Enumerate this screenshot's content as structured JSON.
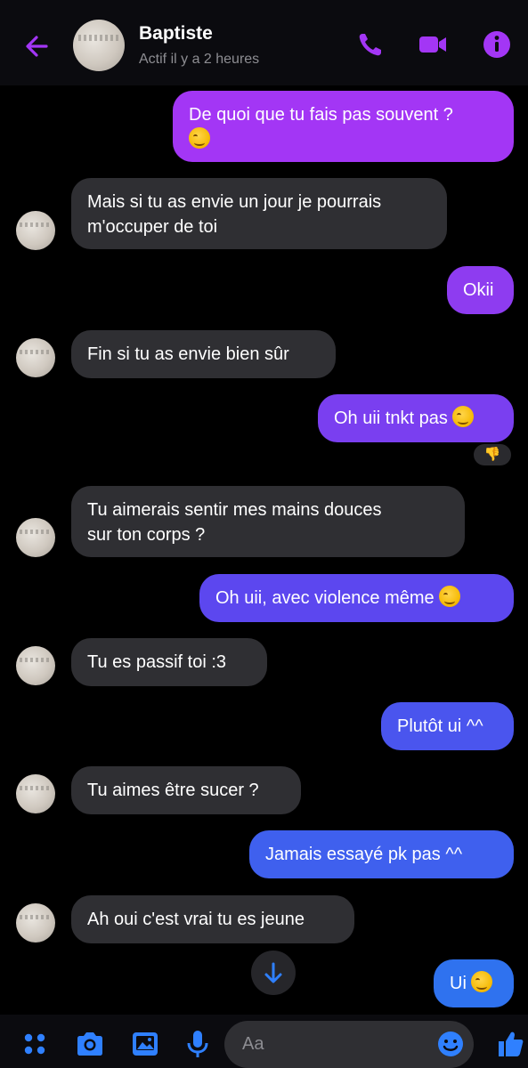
{
  "header": {
    "contact_name": "Baptiste",
    "status": "Actif il y a 2 heures"
  },
  "messages": [
    {
      "side": "out",
      "text": "De quoi que tu fais pas souvent ?",
      "color": "#a336f5"
    },
    {
      "side": "in",
      "line1": "Mais si tu as envie un jour je pourrais",
      "line2": "m'occuper de toi"
    },
    {
      "side": "out",
      "text": "Okii",
      "color": "#8e3cf0"
    },
    {
      "side": "in",
      "text": "Fin si tu as envie bien sûr"
    },
    {
      "side": "out",
      "text": "Oh uii tnkt pas",
      "color": "#7a3ff0",
      "reaction": "👎"
    },
    {
      "side": "in",
      "line1": "Tu aimerais sentir mes mains douces",
      "line2": "sur ton corps ?"
    },
    {
      "side": "out",
      "text": "Oh uii, avec violence même",
      "color": "#5c47ef"
    },
    {
      "side": "in",
      "text": "Tu es passif toi :3"
    },
    {
      "side": "out",
      "text": "Plutôt ui ^^",
      "color": "#4a55ee"
    },
    {
      "side": "in",
      "text": "Tu aimes être sucer ?"
    },
    {
      "side": "out",
      "text": "Jamais essayé pk pas ^^",
      "color": "#3f60ee"
    },
    {
      "side": "in",
      "text": "Ah oui c'est vrai tu es jeune"
    },
    {
      "side": "out",
      "text": "Ui",
      "color": "#2f72ef"
    }
  ],
  "composer": {
    "placeholder": "Aa"
  },
  "colors": {
    "accent": "#a336f5",
    "incoming_bubble": "#2f2f33",
    "composer_icons": "#2f80ff"
  }
}
